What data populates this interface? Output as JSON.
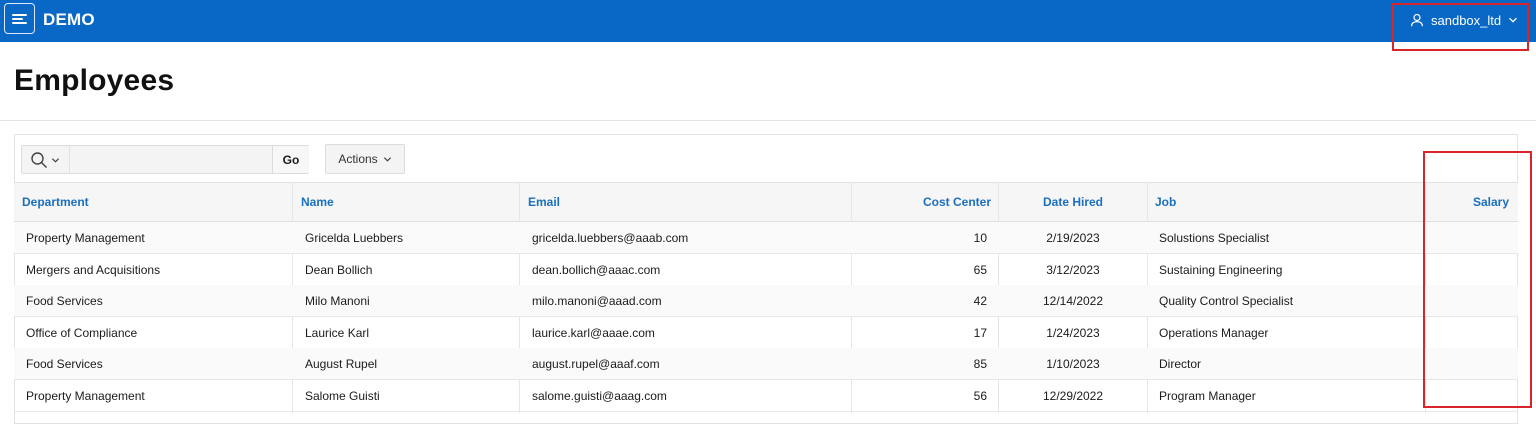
{
  "header": {
    "app_name": "DEMO",
    "user_name": "sandbox_ltd"
  },
  "page": {
    "title": "Employees"
  },
  "toolbar": {
    "search_value": "",
    "go_label": "Go",
    "actions_label": "Actions"
  },
  "table": {
    "columns": [
      "Department",
      "Name",
      "Email",
      "Cost Center",
      "Date Hired",
      "Job",
      "Salary"
    ],
    "rows": [
      [
        "Property Management",
        "Gricelda Luebbers",
        "gricelda.luebbers@aaab.com",
        "10",
        "2/19/2023",
        "Solustions Specialist",
        ""
      ],
      [
        "Mergers and Acquisitions",
        "Dean Bollich",
        "dean.bollich@aaac.com",
        "65",
        "3/12/2023",
        "Sustaining Engineering",
        ""
      ],
      [
        "Food Services",
        "Milo Manoni",
        "milo.manoni@aaad.com",
        "42",
        "12/14/2022",
        "Quality Control Specialist",
        ""
      ],
      [
        "Office of Compliance",
        "Laurice Karl",
        "laurice.karl@aaae.com",
        "17",
        "1/24/2023",
        "Operations Manager",
        ""
      ],
      [
        "Food Services",
        "August Rupel",
        "august.rupel@aaaf.com",
        "85",
        "1/10/2023",
        "Director",
        ""
      ],
      [
        "Property Management",
        "Salome Guisti",
        "salome.guisti@aaag.com",
        "56",
        "12/29/2022",
        "Program Manager",
        ""
      ]
    ]
  },
  "colors": {
    "header_bg": "#0968c5",
    "link_blue": "#1a6fbf",
    "annotation_red": "#d9252a"
  },
  "icons": {
    "menu": "hamburger-icon",
    "user": "user-icon",
    "search": "search-icon",
    "dropdown": "chevron-down-icon"
  }
}
